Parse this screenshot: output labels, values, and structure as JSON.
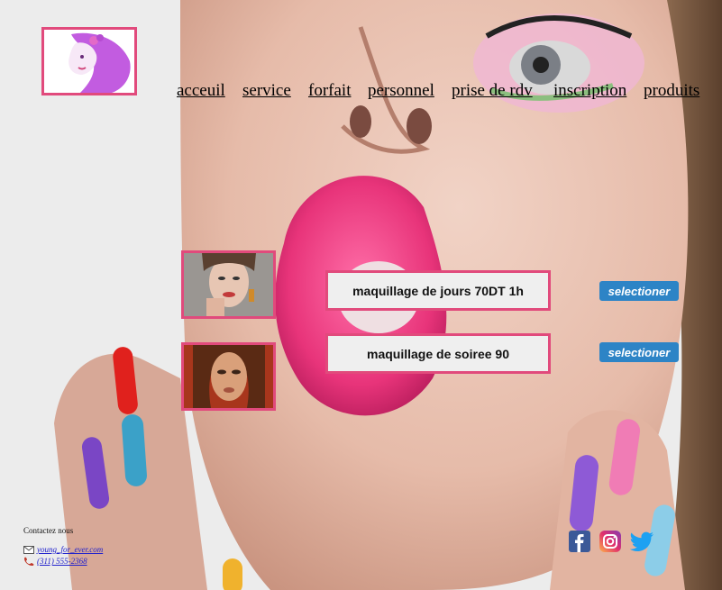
{
  "nav": {
    "items": [
      "acceuil",
      "service",
      "forfait",
      "personnel",
      "prise de rdv",
      "inscription",
      "produits"
    ]
  },
  "offers": [
    {
      "label": "maquillage de jours 70DT 1h",
      "button": "selectioner"
    },
    {
      "label": "maquillage de soiree 90",
      "button": "selectioner"
    }
  ],
  "contact": {
    "title": "Contactez nous",
    "email": "young_for_ever.com",
    "phone": "(311) 555-2368"
  },
  "colors": {
    "accent_border": "#e14a7c",
    "button_bg": "#2d84c6",
    "lips": "#e8347a"
  },
  "icons": {
    "logo": "woman-face-logo",
    "email": "envelope-icon",
    "phone": "phone-icon",
    "social": [
      "facebook-icon",
      "instagram-icon",
      "twitter-icon"
    ]
  }
}
